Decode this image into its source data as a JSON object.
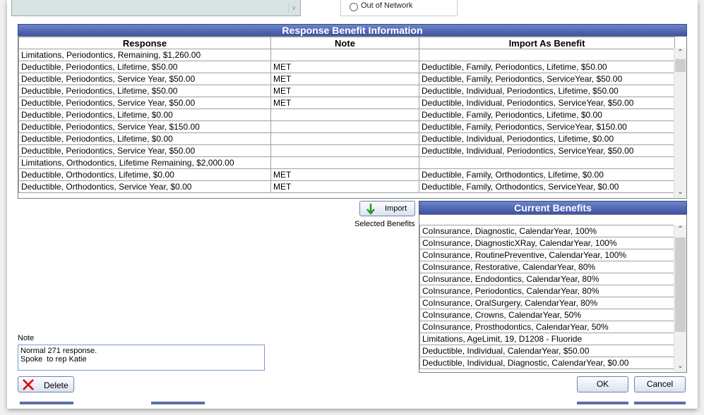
{
  "top": {
    "radio_label": "Out of Network"
  },
  "response_grid": {
    "title": "Response Benefit Information",
    "columns": [
      "Response",
      "Note",
      "Import As Benefit"
    ],
    "rows": [
      [
        "Limitations, Periodontics, Remaining, $1,260.00",
        "",
        ""
      ],
      [
        "Deductible, Periodontics, Lifetime, $50.00",
        "MET",
        "Deductible, Family, Periodontics, Lifetime, $50.00"
      ],
      [
        "Deductible, Periodontics, Service Year, $50.00",
        "MET",
        "Deductible, Family, Periodontics, ServiceYear, $50.00"
      ],
      [
        "Deductible, Periodontics, Lifetime, $50.00",
        "MET",
        "Deductible, Individual, Periodontics, Lifetime, $50.00"
      ],
      [
        "Deductible, Periodontics, Service Year, $50.00",
        "MET",
        "Deductible, Individual, Periodontics, ServiceYear, $50.00"
      ],
      [
        "Deductible, Periodontics, Lifetime, $0.00",
        "",
        "Deductible, Family, Periodontics, Lifetime, $0.00"
      ],
      [
        "Deductible, Periodontics, Service Year, $150.00",
        "",
        "Deductible, Family, Periodontics, ServiceYear, $150.00"
      ],
      [
        "Deductible, Periodontics, Lifetime, $0.00",
        "",
        "Deductible, Individual, Periodontics, Lifetime, $0.00"
      ],
      [
        "Deductible, Periodontics, Service Year, $50.00",
        "",
        "Deductible, Individual, Periodontics, ServiceYear, $50.00"
      ],
      [
        "Limitations, Orthodontics, Lifetime Remaining, $2,000.00",
        "",
        ""
      ],
      [
        "Deductible, Orthodontics, Lifetime, $0.00",
        "MET",
        "Deductible, Family, Orthodontics, Lifetime, $0.00"
      ],
      [
        "Deductible, Orthodontics, Service Year, $0.00",
        "MET",
        "Deductible, Family, Orthodontics, ServiceYear, $0.00"
      ]
    ]
  },
  "import": {
    "button_label": "Import",
    "caption": "Selected Benefits"
  },
  "current_benefits": {
    "title": "Current Benefits",
    "rows": [
      "CoInsurance, Diagnostic, CalendarYear, 100%",
      "CoInsurance, DiagnosticXRay, CalendarYear, 100%",
      "CoInsurance, RoutinePreventive, CalendarYear, 100%",
      "CoInsurance, Restorative, CalendarYear, 80%",
      "CoInsurance, Endodontics, CalendarYear, 80%",
      "CoInsurance, Periodontics, CalendarYear, 80%",
      "CoInsurance, OralSurgery, CalendarYear, 80%",
      "CoInsurance, Crowns, CalendarYear, 50%",
      "CoInsurance, Prosthodontics, CalendarYear, 50%",
      "Limitations, AgeLimit, 19, D1208 - Fluoride",
      "Deductible, Individual, CalendarYear, $50.00",
      "Deductible, Individual, Diagnostic, CalendarYear, $0.00"
    ]
  },
  "note": {
    "label": "Note",
    "value": "Normal 271 response.\nSpoke  to rep Katie"
  },
  "buttons": {
    "delete": "Delete",
    "ok": "OK",
    "cancel": "Cancel"
  },
  "colors": {
    "title_bar": "#3c52a2",
    "delete_icon": "#d40000",
    "import_arrow": "#1a9a1a"
  }
}
